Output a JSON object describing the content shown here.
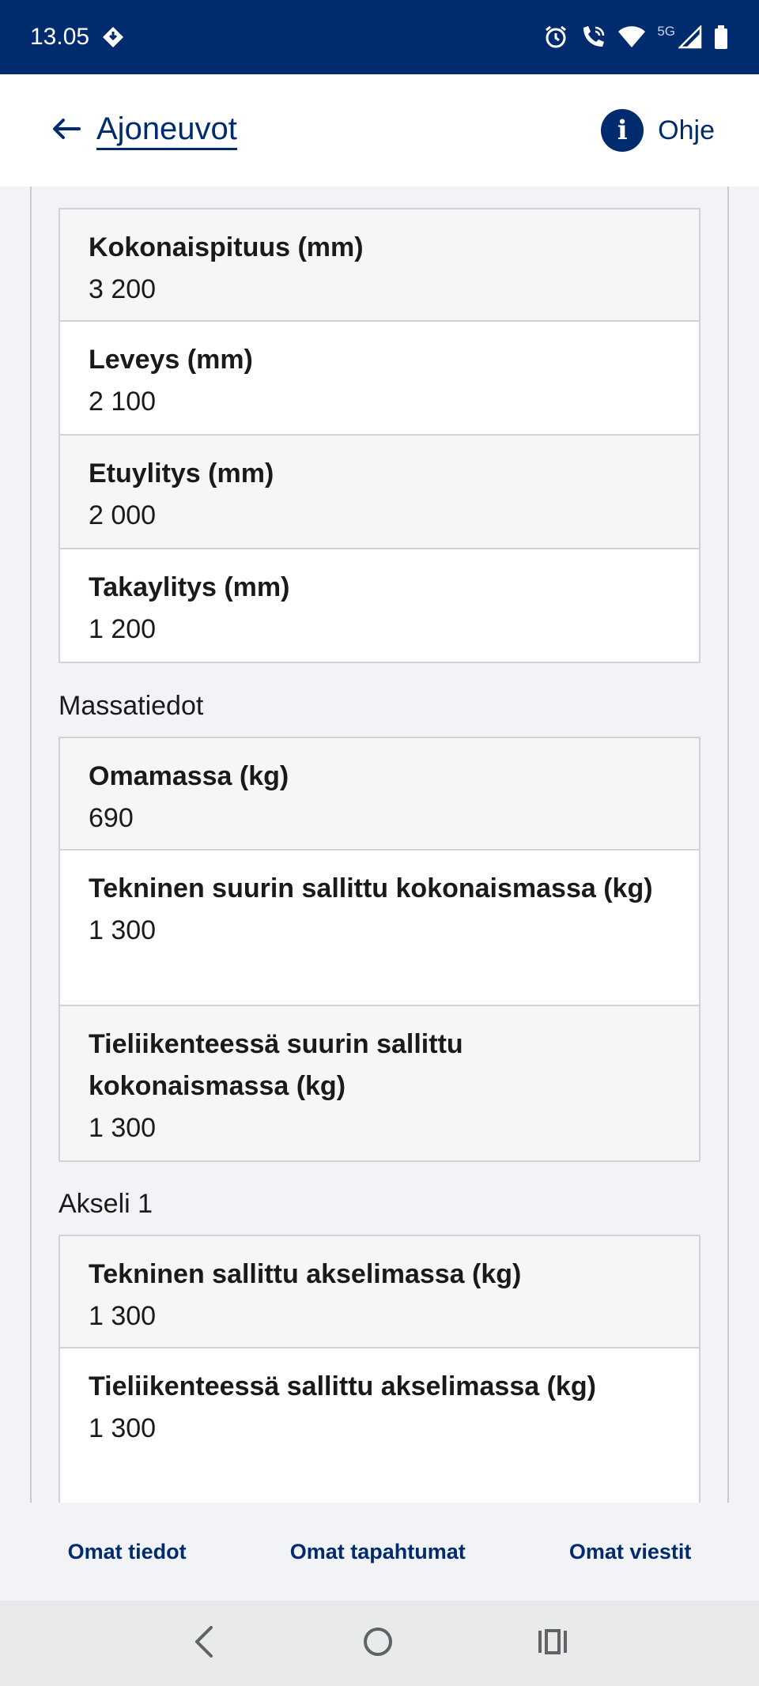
{
  "status_bar": {
    "time": "13.05",
    "network_label": "5G",
    "icons": [
      "app-notification-icon",
      "alarm-icon",
      "wifi-calling-icon",
      "wifi-icon",
      "signal-icon",
      "battery-icon"
    ]
  },
  "header": {
    "back_label": "Ajoneuvot",
    "help_label": "Ohje"
  },
  "sections": {
    "dimensions": {
      "rows": [
        {
          "label": "Kokonaispituus (mm)",
          "value": "3 200"
        },
        {
          "label": "Leveys (mm)",
          "value": "2 100"
        },
        {
          "label": "Etuylitys (mm)",
          "value": "2 000"
        },
        {
          "label": "Takaylitys (mm)",
          "value": "1 200"
        }
      ]
    },
    "mass": {
      "title": "Massatiedot",
      "rows": [
        {
          "label": "Omamassa (kg)",
          "value": "690"
        },
        {
          "label": "Tekninen suurin sallittu kokonaismassa (kg)",
          "value": "1 300"
        },
        {
          "label": "Tieliikenteessä suurin sallittu kokonaismassa (kg)",
          "value": "1 300"
        }
      ]
    },
    "axle1": {
      "title": "Akseli 1",
      "rows": [
        {
          "label": "Tekninen sallittu akselimassa (kg)",
          "value": "1 300"
        },
        {
          "label": "Tieliikenteessä sallittu akselimassa (kg)",
          "value": "1 300"
        }
      ]
    }
  },
  "bottom_nav": {
    "items": [
      "Omat tiedot",
      "Omat tapahtumat",
      "Omat viestit"
    ]
  },
  "colors": {
    "brand": "#002b6e",
    "background": "#f1f3f7",
    "row_shade": "#f6f6f7"
  }
}
